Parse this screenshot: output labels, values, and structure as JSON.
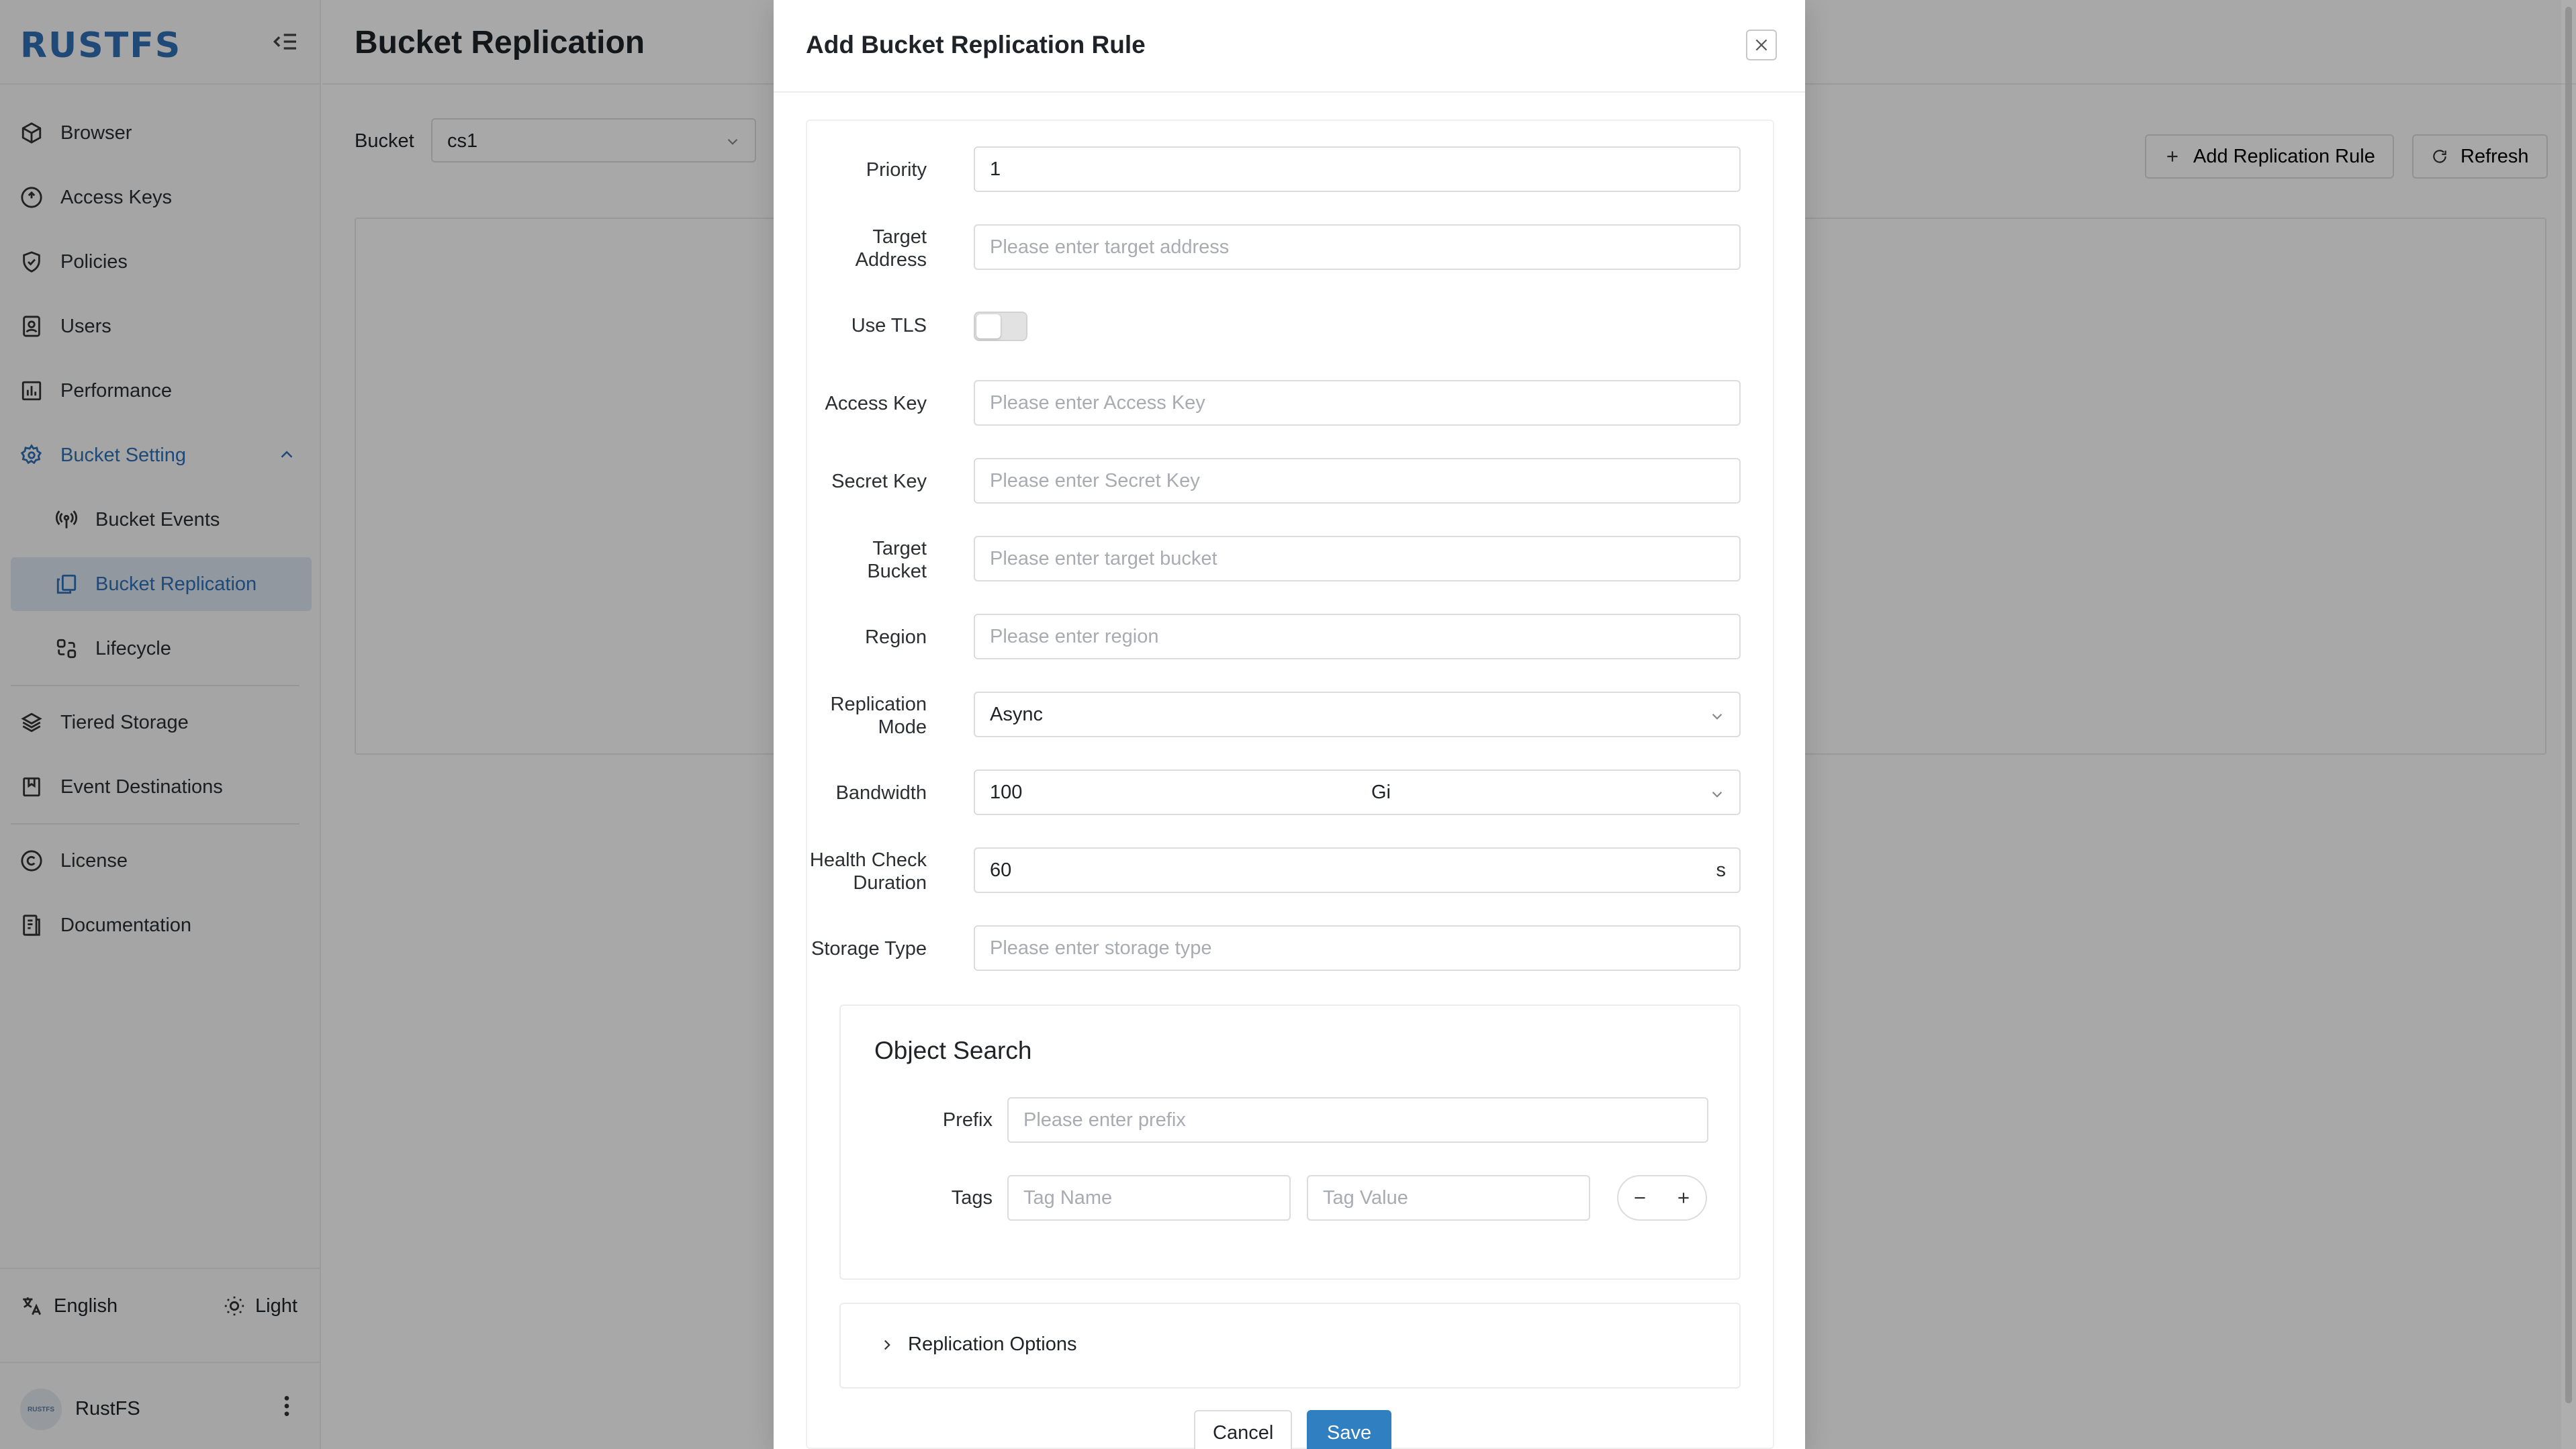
{
  "app": {
    "logo": "RUSTFS"
  },
  "sidebar": {
    "items": [
      {
        "label": "Browser",
        "icon": "cube-icon"
      },
      {
        "label": "Access Keys",
        "icon": "key-circle-icon"
      },
      {
        "label": "Policies",
        "icon": "shield-check-icon"
      },
      {
        "label": "Users",
        "icon": "user-doc-icon"
      },
      {
        "label": "Performance",
        "icon": "bar-chart-icon"
      },
      {
        "label": "Bucket Setting",
        "icon": "gear-icon",
        "expanded": true
      },
      {
        "label": "Bucket Events",
        "icon": "broadcast-icon"
      },
      {
        "label": "Bucket Replication",
        "icon": "copy-icon",
        "active": true
      },
      {
        "label": "Lifecycle",
        "icon": "lifecycle-icon"
      },
      {
        "label": "Tiered Storage",
        "icon": "layers-icon"
      },
      {
        "label": "Event Destinations",
        "icon": "bookmark-icon"
      },
      {
        "label": "License",
        "icon": "copyright-icon"
      },
      {
        "label": "Documentation",
        "icon": "document-icon"
      }
    ],
    "language": "English",
    "theme": "Light",
    "user": {
      "name": "RustFS",
      "avatar_text": "RUSTFS"
    }
  },
  "main": {
    "title": "Bucket Replication",
    "bucket_label": "Bucket",
    "bucket_value": "cs1",
    "add_rule_label": "Add Replication Rule",
    "refresh_label": "Refresh"
  },
  "modal": {
    "title": "Add Bucket Replication Rule",
    "fields": {
      "priority": {
        "label": "Priority",
        "value": "1"
      },
      "target_address": {
        "label_1": "Target",
        "label_2": "Address",
        "placeholder": "Please enter target address"
      },
      "use_tls": {
        "label": "Use TLS",
        "on": false
      },
      "access_key": {
        "label": "Access Key",
        "placeholder": "Please enter Access Key"
      },
      "secret_key": {
        "label": "Secret Key",
        "placeholder": "Please enter Secret Key"
      },
      "target_bucket": {
        "label_1": "Target",
        "label_2": "Bucket",
        "placeholder": "Please enter target bucket"
      },
      "region": {
        "label": "Region",
        "placeholder": "Please enter region"
      },
      "replication_mode": {
        "label_1": "Replication",
        "label_2": "Mode",
        "value": "Async"
      },
      "bandwidth": {
        "label": "Bandwidth",
        "value": "100",
        "unit": "Gi"
      },
      "health_check": {
        "label_1": "Health Check",
        "label_2": "Duration",
        "value": "60",
        "suffix": "s"
      },
      "storage_type": {
        "label": "Storage Type",
        "placeholder": "Please enter storage type"
      }
    },
    "object_search": {
      "title": "Object Search",
      "prefix_label": "Prefix",
      "prefix_placeholder": "Please enter prefix",
      "tags_label": "Tags",
      "tag_name_placeholder": "Tag Name",
      "tag_value_placeholder": "Tag Value"
    },
    "replication_options_label": "Replication Options",
    "cancel_label": "Cancel",
    "save_label": "Save"
  },
  "colors": {
    "accent": "#2f7fc1",
    "logo": "#2f6fb5",
    "active_bg": "#dde7f2"
  }
}
